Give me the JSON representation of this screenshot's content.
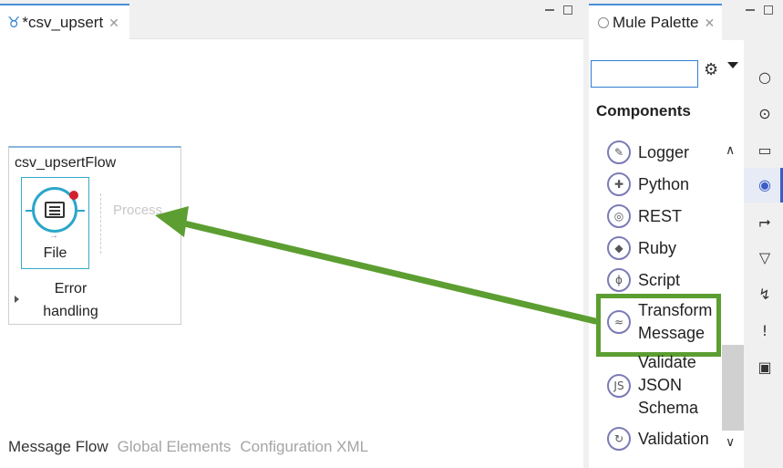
{
  "editor": {
    "tab_label": "*csv_upsert",
    "flow_name": "csv_upsertFlow",
    "source_label": "File",
    "process_label": "Process",
    "error_label": "Error handling",
    "bottom_tabs": [
      "Message Flow",
      "Global Elements",
      "Configuration XML"
    ]
  },
  "palette": {
    "tab_label": "Mule Palette",
    "search_value": "",
    "section_title": "Components",
    "items": [
      {
        "label": "Logger",
        "icon": "pencil-icon"
      },
      {
        "label": "Python",
        "icon": "python-icon"
      },
      {
        "label": "REST",
        "icon": "globe-icon"
      },
      {
        "label": "Ruby",
        "icon": "ruby-icon"
      },
      {
        "label": "Script",
        "icon": "script-icon"
      },
      {
        "label": "Transform Message",
        "icon": "transform-icon"
      },
      {
        "label": "Validate JSON Schema",
        "icon": "js-icon",
        "icon_text": "JS"
      },
      {
        "label": "Validation",
        "icon": "validation-icon"
      }
    ]
  },
  "colors": {
    "highlight": "#5c9e31",
    "accent": "#2f7fd1",
    "error_badge": "#d3202f"
  }
}
